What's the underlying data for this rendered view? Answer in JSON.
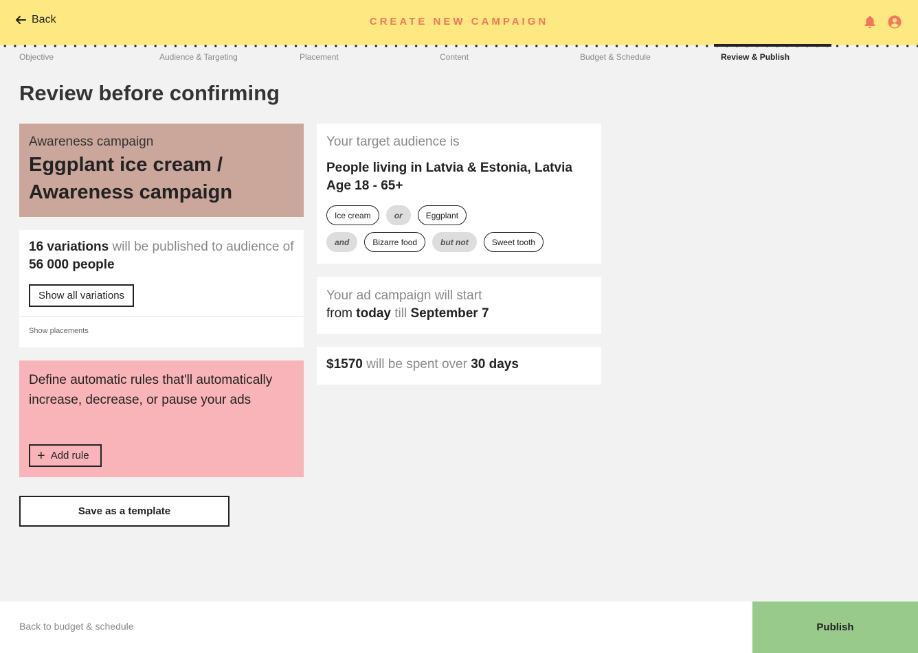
{
  "header": {
    "back_label": "Back",
    "title": "CREATE NEW CAMPAIGN",
    "accent_color": "#f2775a",
    "bar_color": "#fee882"
  },
  "steps": [
    {
      "label": "Objective",
      "active": false
    },
    {
      "label": "Audience & Targeting",
      "active": false
    },
    {
      "label": "Placement",
      "active": false
    },
    {
      "label": "Content",
      "active": false
    },
    {
      "label": "Budget & Schedule",
      "active": false
    },
    {
      "label": "Review & Publish",
      "active": true
    }
  ],
  "page_title": "Review before confirming",
  "campaign": {
    "type": "Awareness campaign",
    "name": "Eggplant ice cream / Awareness campaign"
  },
  "variations": {
    "count_text": "16 variations",
    "middle_text": "will be published to audience of",
    "audience_size": "56 000 people",
    "show_all_label": "Show all variations",
    "show_placements_label": "Show placements"
  },
  "rules": {
    "text": "Define automatic rules that'll automatically increase, decrease, or pause your ads",
    "add_label": "Add rule"
  },
  "template_label": "Save as a template",
  "audience": {
    "label": "Your target audience is",
    "location": "People living in Latvia & Estonia, Latvia",
    "age": "Age 18 - 65+",
    "row1": [
      {
        "text": "Ice cream",
        "operator": false
      },
      {
        "text": "or",
        "operator": true
      },
      {
        "text": "Eggplant",
        "operator": false
      }
    ],
    "row2": [
      {
        "text": "and",
        "operator": true
      },
      {
        "text": "Bizarre food",
        "operator": false
      },
      {
        "text": "but not",
        "operator": true
      },
      {
        "text": "Sweet tooth",
        "operator": false
      }
    ]
  },
  "schedule": {
    "line1": "Your ad campaign will start",
    "from": "from",
    "start": "today",
    "till": "till",
    "end": "September 7"
  },
  "budget": {
    "amount": "$1570",
    "middle": "will be spent over",
    "duration": "30 days"
  },
  "footer": {
    "back_label": "Back to budget & schedule",
    "publish_label": "Publish",
    "publish_color": "#98cb8b"
  }
}
